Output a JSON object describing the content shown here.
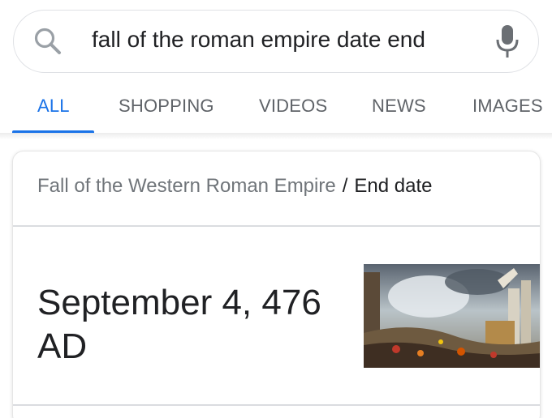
{
  "search": {
    "query": "fall of the roman empire date end",
    "icon": "search-icon",
    "voice_icon": "mic-icon"
  },
  "tabs": [
    {
      "label": "ALL",
      "active": true
    },
    {
      "label": "SHOPPING",
      "active": false
    },
    {
      "label": "VIDEOS",
      "active": false
    },
    {
      "label": "NEWS",
      "active": false
    },
    {
      "label": "IMAGES",
      "active": false
    }
  ],
  "card": {
    "breadcrumb_parent": "Fall of the Western Roman Empire",
    "breadcrumb_separator": "/",
    "breadcrumb_current": "End date",
    "answer": "September 4, 476 AD"
  },
  "colors": {
    "accent": "#1a73e8",
    "text": "#202124",
    "muted": "#70757a",
    "border": "#dfe1e5"
  }
}
